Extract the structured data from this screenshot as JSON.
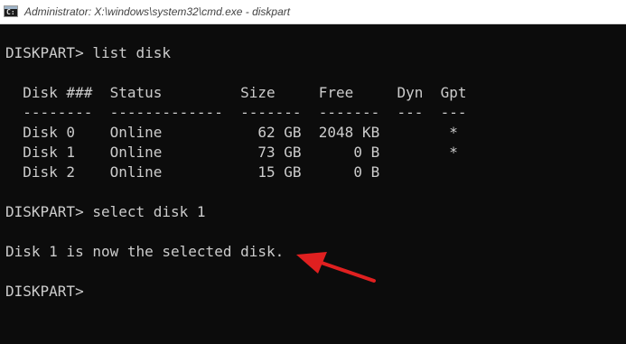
{
  "window": {
    "title": "Administrator: X:\\windows\\system32\\cmd.exe - diskpart",
    "icon": "cmd-icon"
  },
  "console": {
    "prompt_list": "DISKPART> list disk",
    "table_header": "  Disk ###  Status         Size     Free     Dyn  Gpt",
    "table_separator": "  --------  -------------  -------  -------  ---  ---",
    "rows": [
      "  Disk 0    Online           62 GB  2048 KB        *",
      "  Disk 1    Online           73 GB      0 B        *",
      "  Disk 2    Online           15 GB      0 B"
    ],
    "prompt_select": "DISKPART> select disk 1",
    "result": "Disk 1 is now the selected disk.",
    "prompt_final": "DISKPART> "
  },
  "annotation": {
    "arrow_color": "#e02020",
    "icon": "red-arrow-icon"
  }
}
